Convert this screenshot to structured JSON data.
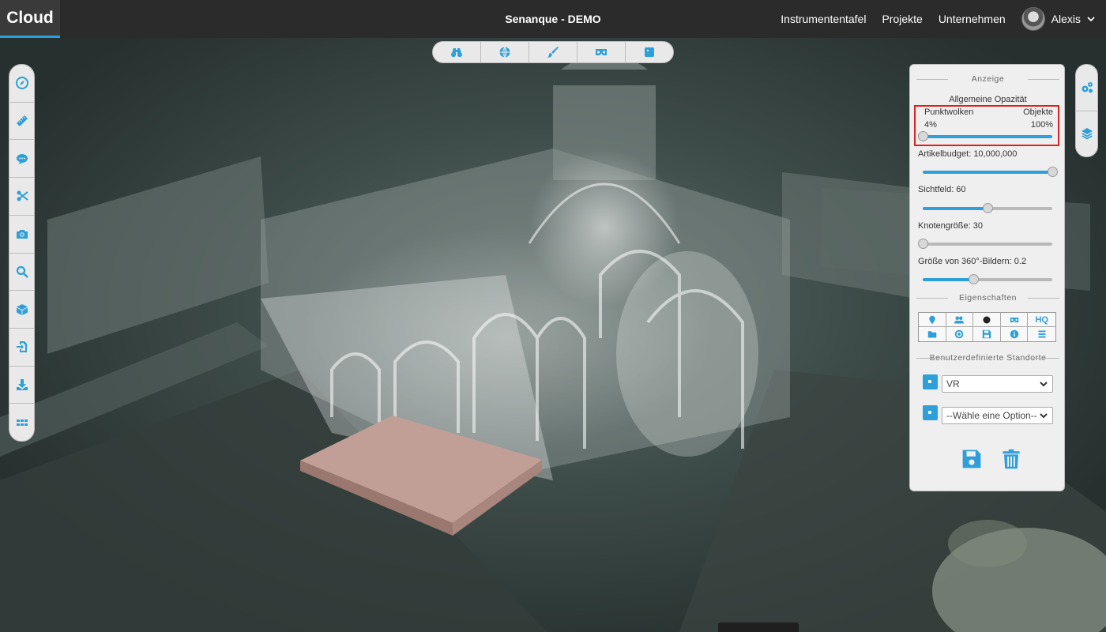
{
  "header": {
    "brand": "Cloud",
    "title": "Senanque - DEMO",
    "nav": [
      "Instrumententafel",
      "Projekte",
      "Unternehmen"
    ],
    "user": "Alexis"
  },
  "colors": {
    "accent": "#2e9fd8",
    "highlight": "#e02020",
    "topbar": "#2b2b2b",
    "panel": "#efefef",
    "model_box": "#b8938a"
  },
  "top_toolbar": [
    "binoculars-icon",
    "globe-icon",
    "brush-icon",
    "vr-goggles-icon",
    "square-icon"
  ],
  "left_toolbar": [
    "compass-icon",
    "ruler-icon",
    "comment-icon",
    "scissors-icon",
    "camera-icon",
    "search-icon",
    "cube-icon",
    "import-icon",
    "download-icon",
    "grid-icon"
  ],
  "right_toolbar": [
    "cogs-icon",
    "layers-icon"
  ],
  "panel": {
    "display_title": "Anzeige",
    "opacity": {
      "label": "Allgemeine Opazität",
      "left_label": "Punktwolken",
      "right_label": "Objekte",
      "left_value": "4%",
      "right_value": "100%",
      "fraction": 0.0
    },
    "sliders": [
      {
        "label": "Artikelbudget: 10,000,000",
        "fraction": 1.0
      },
      {
        "label": "Sichtfeld: 60",
        "fraction": 0.5
      },
      {
        "label": "Knotengröße: 30",
        "fraction": 0.0
      },
      {
        "label": "Größe von 360°-Bildern: 0.2",
        "fraction": 0.39
      }
    ],
    "properties_title": "Eigenschaften",
    "properties_row1": [
      "marker-icon",
      "users-icon",
      "circle-icon",
      "vr-goggles-icon",
      "HQ"
    ],
    "properties_row2": [
      "folder-icon",
      "target-icon",
      "save-icon",
      "info-icon",
      "list-icon"
    ],
    "locations_title": "Benutzerdefinierte Standorte",
    "location_select_1": "VR",
    "location_select_2": "--Wähle eine Option--",
    "save_icon": "save-icon",
    "delete_icon": "trash-icon"
  }
}
